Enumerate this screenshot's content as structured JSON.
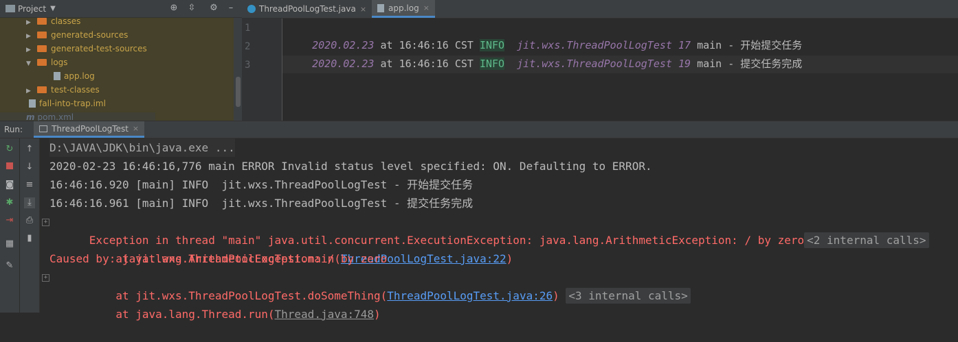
{
  "project": {
    "title": "Project",
    "tree": [
      {
        "label": "classes",
        "type": "folder",
        "expanded": false
      },
      {
        "label": "generated-sources",
        "type": "folder",
        "expanded": false
      },
      {
        "label": "generated-test-sources",
        "type": "folder",
        "expanded": false
      },
      {
        "label": "logs",
        "type": "folder",
        "expanded": true
      },
      {
        "label": "app.log",
        "type": "file"
      },
      {
        "label": "test-classes",
        "type": "folder",
        "expanded": false
      },
      {
        "label": "fall-into-trap.iml",
        "type": "file"
      },
      {
        "label": "pom.xml",
        "type": "file"
      }
    ]
  },
  "editor": {
    "tabs": [
      {
        "label": "ThreadPoolLogTest.java",
        "close": "×",
        "active": false
      },
      {
        "label": "app.log",
        "close": "×",
        "active": true
      }
    ],
    "line_numbers": [
      "1",
      "2",
      "3"
    ],
    "lines": [
      {
        "date": "2020.02.23",
        "at": "at",
        "time": "16:46:16",
        "tz": "CST",
        "level": "INFO",
        "logger": "jit.wxs.ThreadPoolLogTest",
        "line": "17",
        "thread": "main",
        "sep": "-",
        "msg": "开始提交任务"
      },
      {
        "date": "2020.02.23",
        "at": "at",
        "time": "16:46:16",
        "tz": "CST",
        "level": "INFO",
        "logger": "jit.wxs.ThreadPoolLogTest",
        "line": "19",
        "thread": "main",
        "sep": "-",
        "msg": "提交任务完成"
      }
    ]
  },
  "run": {
    "label": "Run:",
    "tab": "ThreadPoolLogTest",
    "tab_close": "×",
    "console": {
      "cmd": "D:\\JAVA\\JDK\\bin\\java.exe ...",
      "error_line": "2020-02-23 16:46:16,776 main ERROR Invalid status level specified: ON. Defaulting to ERROR.",
      "info1": "16:46:16.920 [main] INFO  jit.wxs.ThreadPoolLogTest - 开始提交任务",
      "info2": "16:46:16.961 [main] INFO  jit.wxs.ThreadPoolLogTest - 提交任务完成",
      "exception": "Exception in thread \"main\" java.util.concurrent.ExecutionException: java.lang.ArithmeticException: / by zero",
      "internal1": "<2 internal calls>",
      "at1_prefix": "    at jit.wxs.ThreadPoolLogTest.main(",
      "at1_link": "ThreadPoolLogTest.java:22",
      "close_paren": ")",
      "caused": "Caused by: java.lang.ArithmeticException: / by zero",
      "at2_prefix": "    at jit.wxs.ThreadPoolLogTest.doSomeThing(",
      "at2_link": "ThreadPoolLogTest.java:26",
      "internal2": "<3 internal calls>",
      "at3_prefix": "    at java.lang.Thread.run(",
      "at3_link": "Thread.java:748"
    }
  },
  "colors": {
    "date": "#9876aa",
    "info_bg": "#294436",
    "info_fg": "#5eb98a",
    "logger": "#9876aa",
    "error": "#ff6b68",
    "link": "#589df6",
    "tree_text": "#c9a44a",
    "folder": "#d5742e"
  }
}
